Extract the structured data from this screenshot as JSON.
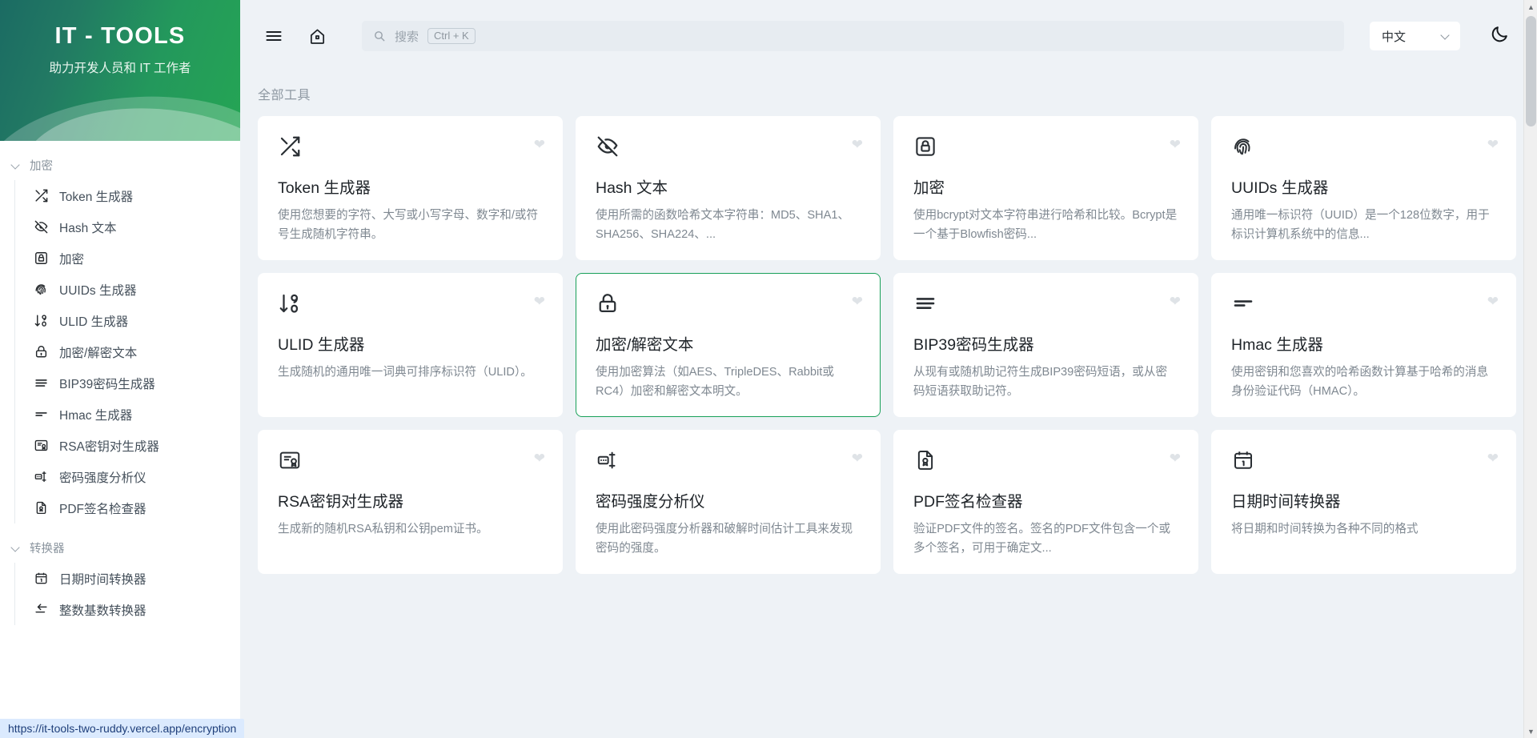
{
  "brand": {
    "title": "IT - TOOLS",
    "subtitle": "助力开发人员和 IT 工作者"
  },
  "topbar": {
    "menu_icon": "hamburger-menu-icon",
    "home_icon": "home-icon",
    "search_placeholder": "搜索",
    "search_shortcut": "Ctrl + K",
    "language_value": "中文",
    "theme_toggle_icon": "moon-icon"
  },
  "sidebar": {
    "groups": [
      {
        "label": "加密",
        "expanded": true,
        "items": [
          {
            "label": "Token 生成器",
            "icon": "shuffle-icon"
          },
          {
            "label": "Hash 文本",
            "icon": "eye-off-icon"
          },
          {
            "label": "加密",
            "icon": "lock-square-icon"
          },
          {
            "label": "UUIDs 生成器",
            "icon": "fingerprint-icon"
          },
          {
            "label": "ULID 生成器",
            "icon": "sort-numbers-icon"
          },
          {
            "label": "加密/解密文本",
            "icon": "padlock-icon"
          },
          {
            "label": "BIP39密码生成器",
            "icon": "lines-icon"
          },
          {
            "label": "Hmac 生成器",
            "icon": "two-lines-icon"
          },
          {
            "label": "RSA密钥对生成器",
            "icon": "certificate-icon"
          },
          {
            "label": "密码强度分析仪",
            "icon": "password-meter-icon"
          },
          {
            "label": "PDF签名检查器",
            "icon": "file-certificate-icon"
          }
        ]
      },
      {
        "label": "转换器",
        "expanded": true,
        "items": [
          {
            "label": "日期时间转换器",
            "icon": "calendar-icon"
          },
          {
            "label": "整数基数转换器",
            "icon": "arrow-left-icon"
          }
        ]
      }
    ]
  },
  "main": {
    "section_title": "全部工具",
    "cards": [
      {
        "title": "Token 生成器",
        "desc": "使用您想要的字符、大写或小写字母、数字和/或符号生成随机字符串。",
        "icon": "shuffle-icon",
        "selected": false
      },
      {
        "title": "Hash 文本",
        "desc": "使用所需的函数哈希文本字符串：MD5、SHA1、SHA256、SHA224、...",
        "icon": "eye-off-icon",
        "selected": false
      },
      {
        "title": "加密",
        "desc": "使用bcrypt对文本字符串进行哈希和比较。Bcrypt是一个基于Blowfish密码...",
        "icon": "lock-square-icon",
        "selected": false
      },
      {
        "title": "UUIDs 生成器",
        "desc": "通用唯一标识符（UUID）是一个128位数字，用于标识计算机系统中的信息...",
        "icon": "fingerprint-icon",
        "selected": false
      },
      {
        "title": "ULID 生成器",
        "desc": "生成随机的通用唯一词典可排序标识符（ULID）。",
        "icon": "sort-numbers-icon",
        "selected": false
      },
      {
        "title": "加密/解密文本",
        "desc": "使用加密算法（如AES、TripleDES、Rabbit或RC4）加密和解密文本明文。",
        "icon": "padlock-icon",
        "selected": true
      },
      {
        "title": "BIP39密码生成器",
        "desc": "从现有或随机助记符生成BIP39密码短语，或从密码短语获取助记符。",
        "icon": "lines-icon",
        "selected": false
      },
      {
        "title": "Hmac 生成器",
        "desc": "使用密钥和您喜欢的哈希函数计算基于哈希的消息身份验证代码（HMAC）。",
        "icon": "two-lines-icon",
        "selected": false
      },
      {
        "title": "RSA密钥对生成器",
        "desc": "生成新的随机RSA私钥和公钥pem证书。",
        "icon": "certificate-icon",
        "selected": false
      },
      {
        "title": "密码强度分析仪",
        "desc": "使用此密码强度分析器和破解时间估计工具来发现密码的强度。",
        "icon": "password-meter-icon",
        "selected": false
      },
      {
        "title": "PDF签名检查器",
        "desc": "验证PDF文件的签名。签名的PDF文件包含一个或多个签名，可用于确定文...",
        "icon": "file-certificate-icon",
        "selected": false
      },
      {
        "title": "日期时间转换器",
        "desc": "将日期和时间转换为各种不同的格式",
        "icon": "calendar-icon",
        "selected": false
      }
    ],
    "favorite_icon": "heart-icon"
  },
  "statusbar": {
    "url": "https://it-tools-two-ruddy.vercel.app/encryption"
  },
  "colors": {
    "accent": "#18a058",
    "brand_green_dark": "#1b6b63",
    "brand_green_light": "#25a554",
    "page_bg": "#eef2f6",
    "card_bg": "#ffffff",
    "status_bg": "#dbeafe"
  }
}
